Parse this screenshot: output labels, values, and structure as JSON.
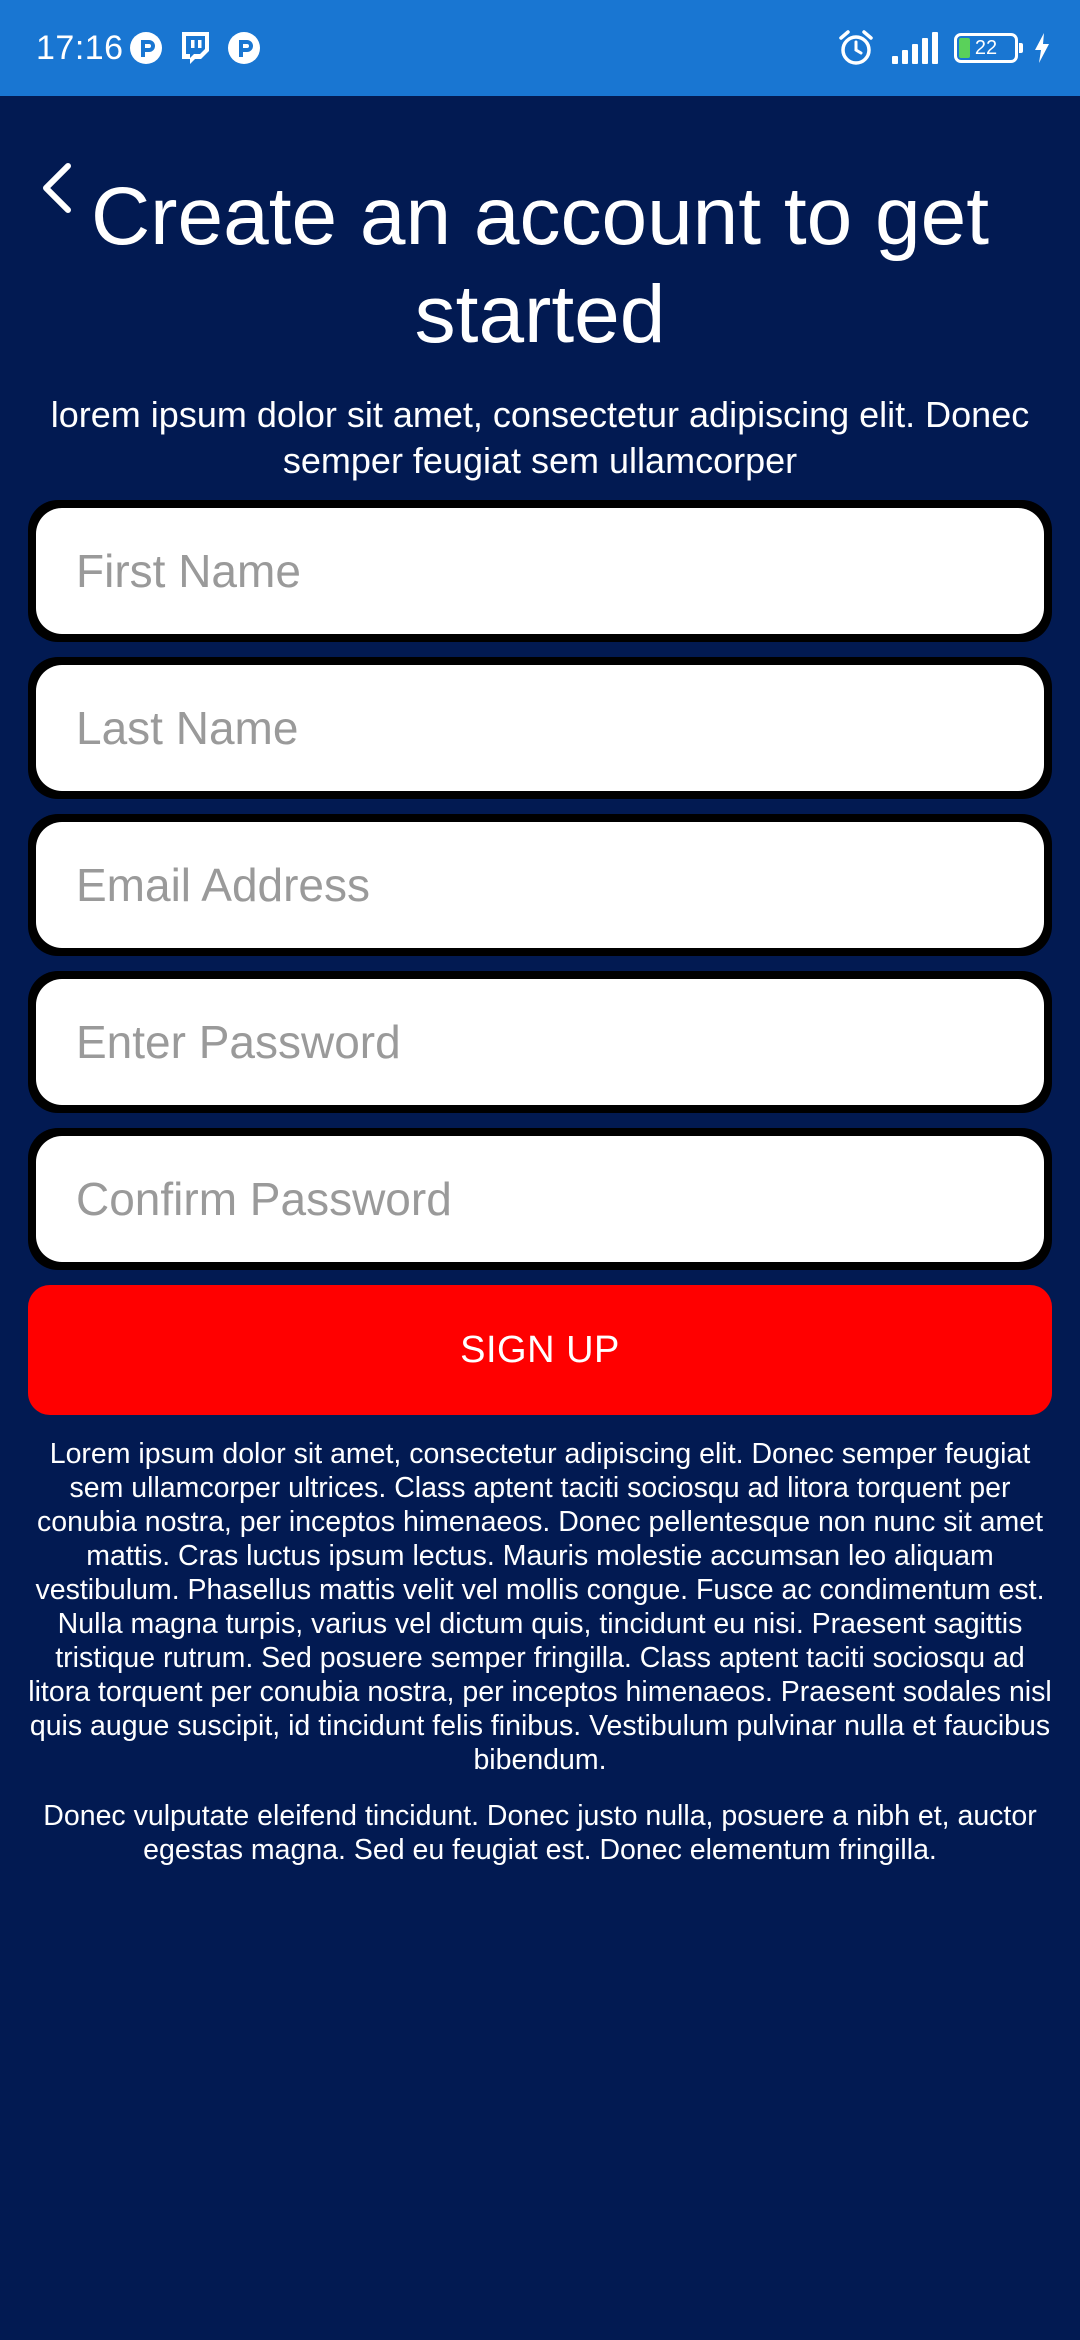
{
  "status_bar": {
    "time": "17:16",
    "left_icons": [
      "app-p-icon",
      "twitch-icon",
      "app-p-icon"
    ],
    "right_icons": [
      "alarm-icon",
      "signal-icon",
      "battery-icon",
      "charging-icon"
    ],
    "battery_level": "22",
    "battery_fraction": 0.22,
    "background_color": "#1976d2"
  },
  "header": {
    "back_icon": "chevron-left-icon",
    "title": "Create an account to get started",
    "subtitle": "lorem ipsum dolor sit amet, consectetur adipiscing elit. Donec semper feugiat sem ullamcorper"
  },
  "form": {
    "first_name": {
      "placeholder": "First Name",
      "value": ""
    },
    "last_name": {
      "placeholder": "Last Name",
      "value": ""
    },
    "email": {
      "placeholder": "Email Address",
      "value": ""
    },
    "password": {
      "placeholder": "Enter Password",
      "value": ""
    },
    "confirm_password": {
      "placeholder": "Confirm Password",
      "value": ""
    }
  },
  "signup_button": {
    "label": "SIGN UP",
    "color": "#ff0000"
  },
  "terms": {
    "paragraph_1": "Lorem ipsum dolor sit amet, consectetur adipiscing elit. Donec semper feugiat sem ullamcorper ultrices. Class aptent taciti sociosqu ad litora torquent per conubia nostra, per inceptos himenaeos. Donec pellentesque non nunc sit amet mattis. Cras luctus ipsum lectus. Mauris molestie accumsan leo aliquam vestibulum. Phasellus mattis velit vel mollis congue. Fusce ac condimentum est. Nulla magna turpis, varius vel dictum quis, tincidunt eu nisi. Praesent sagittis tristique rutrum. Sed posuere semper fringilla. Class aptent taciti sociosqu ad litora torquent per conubia nostra, per inceptos himenaeos. Praesent sodales nisl quis augue suscipit, id tincidunt felis finibus. Vestibulum pulvinar nulla et faucibus bibendum.",
    "paragraph_2": "Donec vulputate eleifend tincidunt. Donec justo nulla, posuere a nibh et, auctor egestas magna. Sed eu feugiat est. Donec elementum fringilla."
  },
  "theme": {
    "background": "#021a52",
    "field_border": "#000000",
    "placeholder_color": "#9a9a9a"
  }
}
